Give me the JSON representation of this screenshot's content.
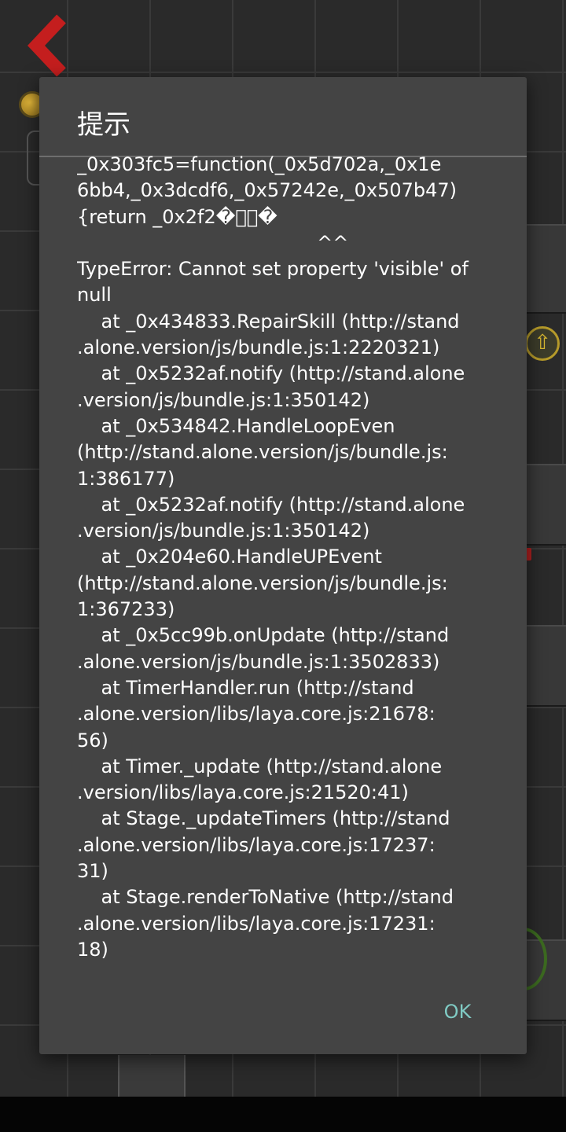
{
  "dialog": {
    "title": "提示",
    "message_lines": [
      "_0x303fc5=function(_0x5d702a,_0x1e",
      "6bb4,_0x3dcdf6,_0x57242e,_0x507b47)",
      "{return _0x2f2�\u0000\u0000�",
      "                                        ^^",
      "TypeError: Cannot set property 'visible' of",
      "null",
      "    at _0x434833.RepairSkill (http://stand",
      ".alone.version/js/bundle.js:1:2220321)",
      "    at _0x5232af.notify (http://stand.alone",
      ".version/js/bundle.js:1:350142)",
      "    at _0x534842.HandleLoopEven",
      "(http://stand.alone.version/js/bundle.js:",
      "1:386177)",
      "    at _0x5232af.notify (http://stand.alone",
      ".version/js/bundle.js:1:350142)",
      "    at _0x204e60.HandleUPEvent",
      "(http://stand.alone.version/js/bundle.js:",
      "1:367233)",
      "    at _0x5cc99b.onUpdate (http://stand",
      ".alone.version/js/bundle.js:1:3502833)",
      "    at TimerHandler.run (http://stand",
      ".alone.version/libs/laya.core.js:21678:",
      "56)",
      "    at Timer._update (http://stand.alone",
      ".version/libs/laya.core.js:21520:41)",
      "    at Stage._updateTimers (http://stand",
      ".alone.version/libs/laya.core.js:17237:",
      "31)",
      "    at Stage.renderToNative (http://stand",
      ".alone.version/libs/laya.core.js:17231:",
      "18)"
    ],
    "ok_label": "OK"
  },
  "colors": {
    "dialog_bg": "#444444",
    "accent": "#80cbc4",
    "text": "#ffffff"
  }
}
